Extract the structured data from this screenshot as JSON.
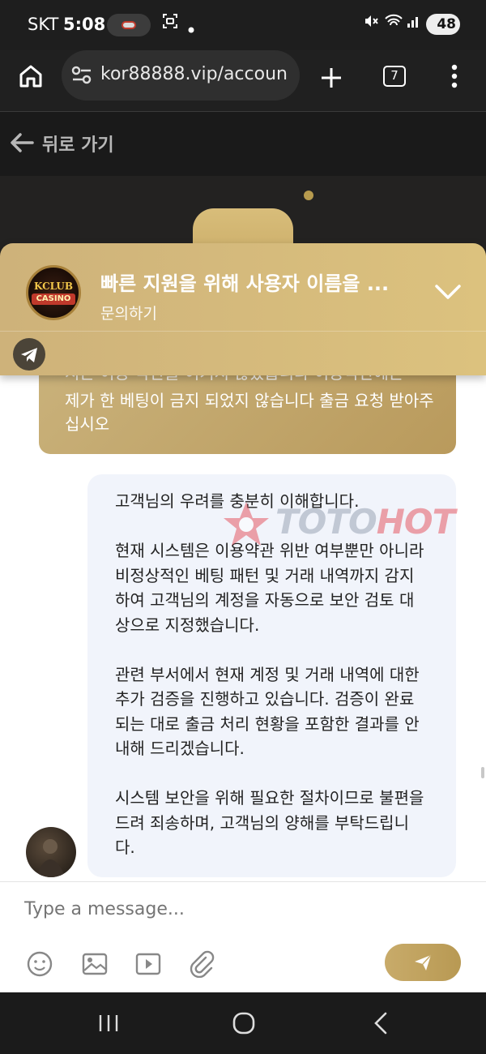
{
  "status_bar": {
    "carrier": "SKT",
    "time": "5:08",
    "battery": "48"
  },
  "browser": {
    "url": "kor88888.vip/accoun",
    "tab_count": "7"
  },
  "nav": {
    "back_label": "뒤로 가기"
  },
  "banner": {
    "title": "빠른 지원을 위해 사용자 이름을 ...",
    "subtitle": "문의하기",
    "logo_line1": "KCLUB",
    "logo_line2": "CASINO"
  },
  "messages": {
    "user": {
      "partial_line": "지는 이용 약관을 어기지 않았습니다 이용약관에는",
      "lines": "제가 한 베팅이 금지 되었지 않습니다 출금 요청 받아주십시오"
    },
    "agent": {
      "paragraphs": [
        "고객님의 우려를 충분히 이해합니다.",
        "현재 시스템은 이용약관 위반 여부뿐만 아니라 비정상적인 베팅 패턴 및 거래 내역까지 감지하여 고객님의 계정을 자동으로 보안 검토 대상으로 지정했습니다.",
        "관련 부서에서 현재 계정 및 거래 내역에 대한 추가 검증을 진행하고 있습니다. 검증이 완료되는 대로 출금 처리 현황을 포함한 결과를 안내해 드리겠습니다.",
        "시스템 보안을 위해 필요한 절차이므로 불편을 드려 죄송하며, 고객님의 양해를 부탁드립니다."
      ]
    }
  },
  "watermark": {
    "toto": "TOTO",
    "hot": "HOT"
  },
  "composer": {
    "placeholder": "Type a message..."
  },
  "icons": {
    "home": "home-icon",
    "site_settings": "tune-icon",
    "new_tab": "plus-icon",
    "tabs": "tab-switcher-icon",
    "menu": "more-vert-icon",
    "back": "arrow-left-icon",
    "telegram": "telegram-icon",
    "emoji": "emoji-icon",
    "image": "image-icon",
    "video": "video-icon",
    "attach": "paperclip-icon",
    "send": "send-icon"
  },
  "colors": {
    "accent_gold": "#c9ad6c",
    "agent_bubble": "#f1f4fb",
    "watermark_red": "#e55a66"
  }
}
